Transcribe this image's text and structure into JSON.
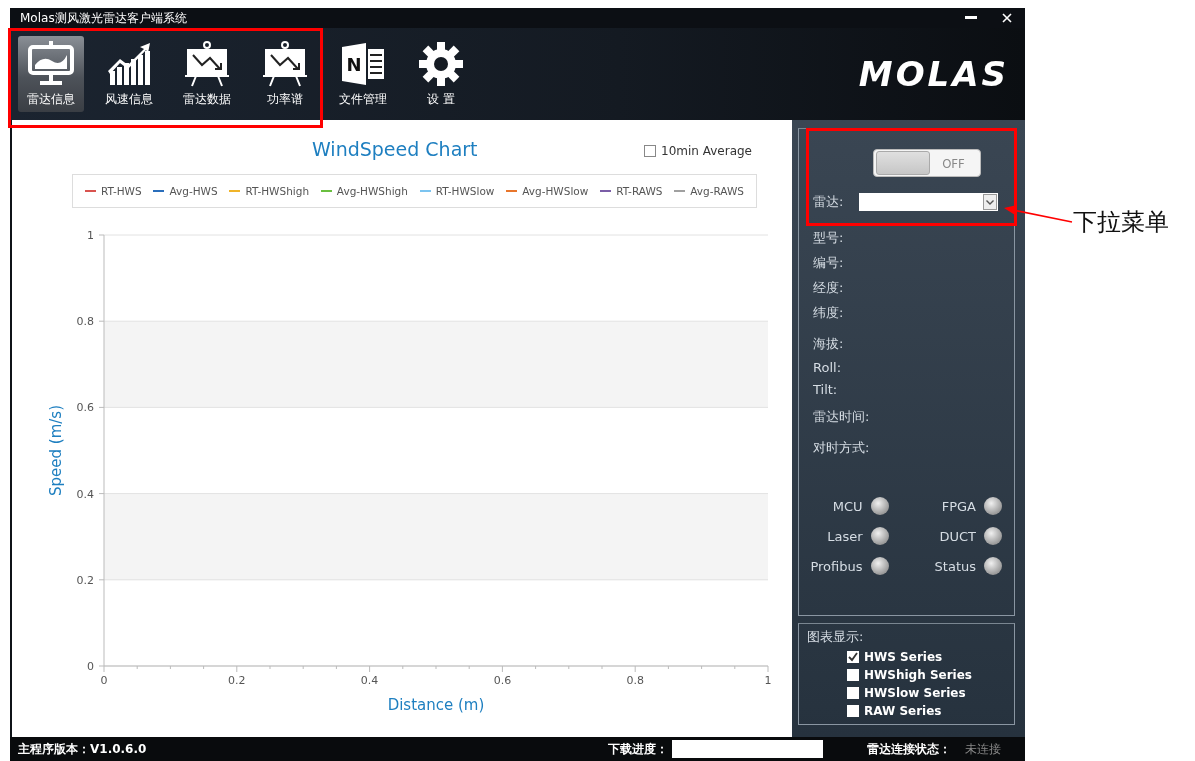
{
  "window": {
    "title": "Molas测风激光雷达客户端系统"
  },
  "toolbar": {
    "items": [
      {
        "label": "雷达信息",
        "selected": true
      },
      {
        "label": "风速信息",
        "selected": false
      },
      {
        "label": "雷达数据",
        "selected": false
      },
      {
        "label": "功率谱",
        "selected": false
      },
      {
        "label": "文件管理",
        "selected": false,
        "icon_letter": "N"
      },
      {
        "label": "设 置",
        "selected": false
      }
    ],
    "logo": "MOLAS"
  },
  "chart": {
    "average_checkbox": {
      "label": "10min Average",
      "checked": false
    },
    "chart_data": {
      "type": "line",
      "title": "WindSpeed Chart",
      "xlabel": "Distance  (m)",
      "ylabel": "Speed  (m/s)",
      "categories": [
        "0",
        "0.2",
        "0.4",
        "0.6",
        "0.8",
        "1"
      ],
      "ylim": [
        0,
        1
      ],
      "grid": true,
      "yticks": [
        0,
        0.2,
        0.4,
        0.6,
        0.8,
        1
      ],
      "series": [
        {
          "name": "RT-HWS",
          "color": "#d9534f",
          "values": [
            null,
            null,
            null,
            null,
            null,
            null
          ]
        },
        {
          "name": "Avg-HWS",
          "color": "#2a6ebb",
          "values": [
            null,
            null,
            null,
            null,
            null,
            null
          ]
        },
        {
          "name": "RT-HWShigh",
          "color": "#f0b429",
          "values": [
            null,
            null,
            null,
            null,
            null,
            null
          ]
        },
        {
          "name": "Avg-HWShigh",
          "color": "#6abf40",
          "values": [
            null,
            null,
            null,
            null,
            null,
            null
          ]
        },
        {
          "name": "RT-HWSlow",
          "color": "#7cc4f0",
          "values": [
            null,
            null,
            null,
            null,
            null,
            null
          ]
        },
        {
          "name": "Avg-HWSlow",
          "color": "#e8762c",
          "values": [
            null,
            null,
            null,
            null,
            null,
            null
          ]
        },
        {
          "name": "RT-RAWS",
          "color": "#7b5ea7",
          "values": [
            null,
            null,
            null,
            null,
            null,
            null
          ]
        },
        {
          "name": "Avg-RAWS",
          "color": "#a0a0a0",
          "values": [
            null,
            null,
            null,
            null,
            null,
            null
          ]
        }
      ]
    }
  },
  "panel": {
    "power_switch": {
      "label": "OFF",
      "on": false
    },
    "radar_select": {
      "label": "雷达:"
    },
    "fields": [
      "型号:",
      "编号:",
      "经度:",
      "纬度:",
      "海拔:",
      "Roll:",
      "Tilt:",
      "雷达时间:",
      "对时方式:"
    ],
    "indicators": [
      {
        "label": "MCU",
        "on": false
      },
      {
        "label": "FPGA",
        "on": false
      },
      {
        "label": "Laser",
        "on": false
      },
      {
        "label": "DUCT",
        "on": false
      },
      {
        "label": "Profibus",
        "on": false
      },
      {
        "label": "Status",
        "on": false
      }
    ],
    "display_group": {
      "title": "图表显示:",
      "options": [
        {
          "label": "HWS Series",
          "checked": true
        },
        {
          "label": "HWShigh Series",
          "checked": false
        },
        {
          "label": "HWSlow Series",
          "checked": false
        },
        {
          "label": "RAW Series",
          "checked": false
        }
      ]
    }
  },
  "status_bar": {
    "version": "主程序版本：V1.0.6.0",
    "download_label": "下载进度：",
    "download_progress": {
      "level": 0
    },
    "connection_label": "雷达连接状态：",
    "connection_state": "未连接"
  },
  "annotation": {
    "label": "下拉菜单"
  }
}
